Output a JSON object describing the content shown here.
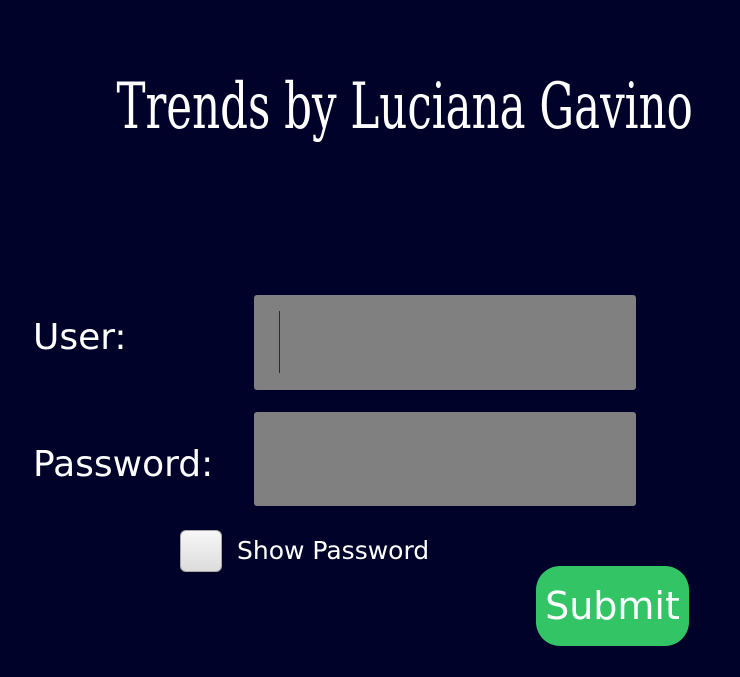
{
  "app": {
    "title": "Trends by Luciana Gavino"
  },
  "form": {
    "user_label": "User:",
    "user_value": "",
    "password_label": "Password:",
    "password_value": "",
    "show_password_label": "Show Password",
    "show_password_checked": false,
    "submit_label": "Submit"
  },
  "colors": {
    "background": "#00022a",
    "field": "#808080",
    "submit": "#33c466",
    "text": "#ffffff"
  }
}
